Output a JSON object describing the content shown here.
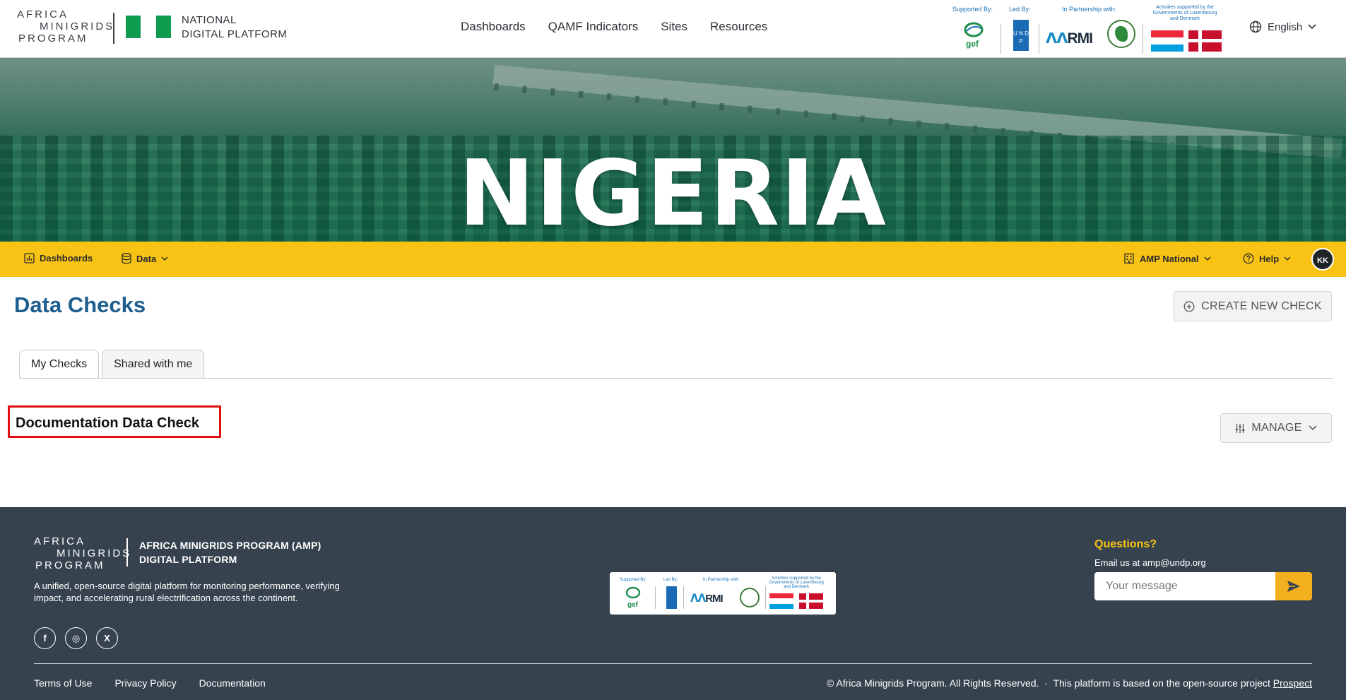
{
  "header": {
    "logo": {
      "line1": "AFRICA",
      "line2": "MINIGRIDS",
      "line3": "PROGRAM"
    },
    "platform_title_line1": "NATIONAL",
    "platform_title_line2": "DIGITAL PLATFORM",
    "nav": [
      "Dashboards",
      "QAMF Indicators",
      "Sites",
      "Resources"
    ],
    "partners": {
      "supported_by": "Supported By:",
      "led_by": "Led By:",
      "partnership": "In Partnership with:",
      "activities": "Activities supported by the Governments of Luxembourg and Denmark",
      "gef": "gef",
      "undp": "U N D P",
      "rmi": "RMI"
    },
    "language": "English"
  },
  "hero": {
    "title": "NIGERIA"
  },
  "subnav": {
    "dashboards": "Dashboards",
    "data": "Data",
    "org": "AMP National",
    "help": "Help",
    "avatar": "KK"
  },
  "page": {
    "title": "Data Checks",
    "create_button": "CREATE NEW CHECK",
    "tabs": [
      {
        "label": "My Checks",
        "active": true
      },
      {
        "label": "Shared with me",
        "active": false
      }
    ],
    "check_title": "Documentation Data Check",
    "manage_button": "MANAGE"
  },
  "footer": {
    "logo": {
      "line1": "AFRICA",
      "line2": "MINIGRIDS",
      "line3": "PROGRAM"
    },
    "title_line1": "AFRICA MINIGRIDS PROGRAM (AMP)",
    "title_line2": "DIGITAL PLATFORM",
    "description": "A unified, open-source digital platform for monitoring performance, verifying impact, and accelerating rural electrification across the continent.",
    "social": [
      "f",
      "◎",
      "X"
    ],
    "questions": "Questions?",
    "email_line": "Email us at amp@undp.org",
    "message_placeholder": "Your message",
    "links": [
      "Terms of Use",
      "Privacy Policy",
      "Documentation"
    ],
    "copyright": "© Africa Minigrids Program. All Rights Reserved.",
    "prospect_text": "This platform is based on the open-source project",
    "prospect_link": "Prospect"
  },
  "colors": {
    "accent_yellow": "#f8c315",
    "title_blue": "#1c5f8f",
    "footer_bg": "#36434f",
    "highlight_red": "#e01010",
    "nigeria_green": "#0e9a4f"
  },
  "icons": [
    "globe-icon",
    "chevron-down-icon",
    "bar-chart-icon",
    "database-icon",
    "building-icon",
    "help-circle-icon",
    "plus-circle-icon",
    "sliders-icon",
    "send-icon",
    "facebook-icon",
    "instagram-icon",
    "x-icon"
  ]
}
